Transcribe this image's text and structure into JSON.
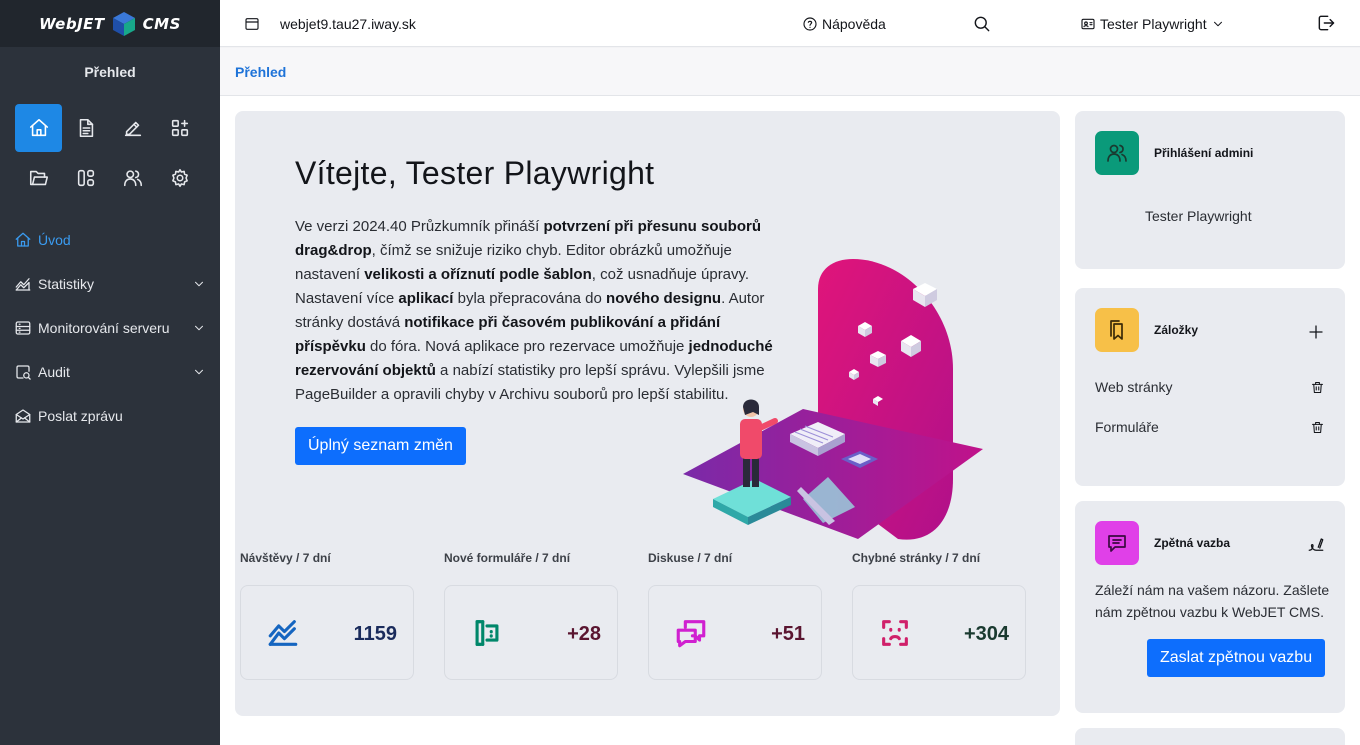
{
  "app": {
    "logo_left": "WebJET",
    "logo_right": "CMS"
  },
  "sidebar": {
    "title": "Přehled",
    "icons": [
      "home-icon",
      "document-icon",
      "edit-icon",
      "apps-icon",
      "folder-icon",
      "templates-icon",
      "users-icon",
      "settings-icon"
    ],
    "items": [
      {
        "label": "Úvod",
        "icon": "home-icon",
        "active": true
      },
      {
        "label": "Statistiky",
        "icon": "chart-icon"
      },
      {
        "label": "Monitorování serveru",
        "icon": "server-icon"
      },
      {
        "label": "Audit",
        "icon": "audit-icon"
      },
      {
        "label": "Poslat zprávu",
        "icon": "mail-icon"
      }
    ]
  },
  "topbar": {
    "domain": "webjet9.tau27.iway.sk",
    "help": "Nápověda",
    "user": "Tester Playwright"
  },
  "breadcrumb": "Přehled",
  "welcome": {
    "title": "Vítejte, Tester Playwright",
    "button": "Úplný seznam změn"
  },
  "stats": [
    {
      "label": "Návštěvy / 7 dní",
      "value": "1159",
      "icon": "chart-line-icon",
      "color": "#1565c0",
      "value_color": "#1a2b5c"
    },
    {
      "label": "Nové formuláře / 7 dní",
      "value": "+28",
      "icon": "form-icon",
      "color": "#00876a",
      "value_color": "#5a1530"
    },
    {
      "label": "Diskuse / 7 dní",
      "value": "+51",
      "icon": "discussion-icon",
      "color": "#d020d0",
      "value_color": "#5a1530"
    },
    {
      "label": "Chybné stránky / 7 dní",
      "value": "+304",
      "icon": "error-face-icon",
      "color": "#d0206a",
      "value_color": "#1a3a30"
    }
  ],
  "admin_card": {
    "title": "Přihlášení admini",
    "user": "Tester Playwright",
    "color": "#0a9a7a"
  },
  "bookmarks_card": {
    "title": "Záložky",
    "color": "#f7c048",
    "items": [
      "Web stránky",
      "Formuláře"
    ]
  },
  "feedback_card": {
    "title": "Zpětná vazba",
    "color": "#e040e8",
    "text": "Záleží nám na vašem názoru. Zašlete nám zpětnou vazbu k WebJET CMS.",
    "button": "Zaslat zpětnou vazbu"
  }
}
